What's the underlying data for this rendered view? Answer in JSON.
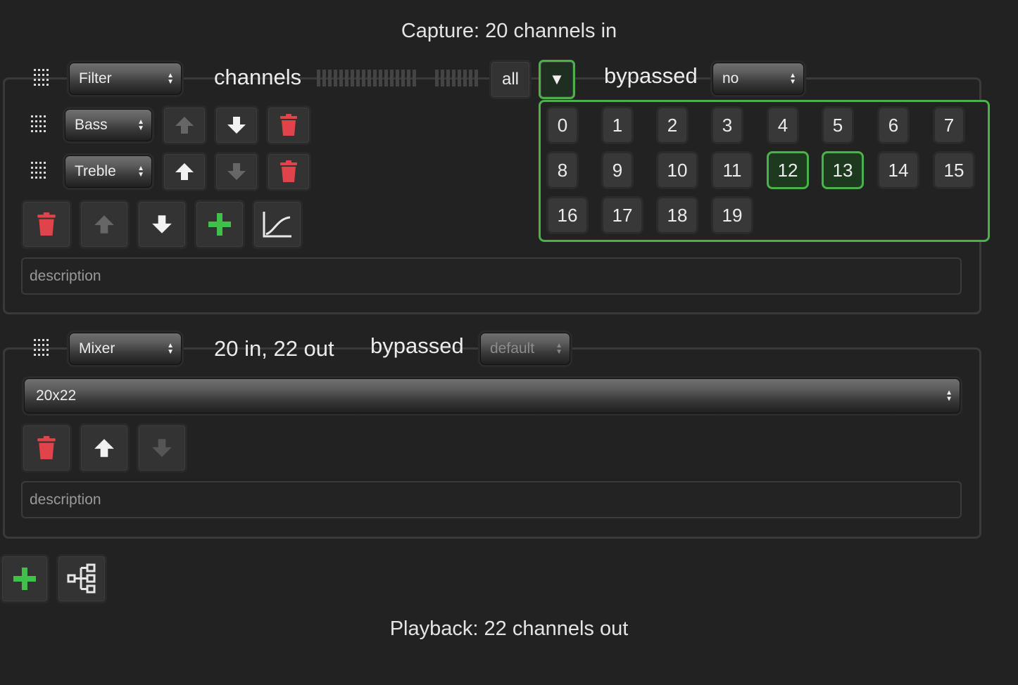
{
  "capture_title": "Capture: 20 channels in",
  "playback_title": "Playback: 22 channels out",
  "filter_step": {
    "type_select": "Filter",
    "channels_label": "channels",
    "all_button": "all",
    "dropdown_toggle": "▼",
    "bypassed_label": "bypassed",
    "bypassed_value": "no",
    "filters": [
      {
        "name": "Bass"
      },
      {
        "name": "Treble"
      }
    ],
    "channel_options": [
      "0",
      "1",
      "2",
      "3",
      "4",
      "5",
      "6",
      "7",
      "8",
      "9",
      "10",
      "11",
      "12",
      "13",
      "14",
      "15",
      "16",
      "17",
      "18",
      "19"
    ],
    "selected_channels": [
      "12",
      "13"
    ],
    "description_placeholder": "description"
  },
  "mixer_step": {
    "type_select": "Mixer",
    "io_label": "20 in, 22 out",
    "bypassed_label": "bypassed",
    "bypassed_value": "default",
    "mixer_select": "20x22",
    "description_placeholder": "description"
  },
  "colors": {
    "background": "#222222",
    "accent_green": "#4cb04c",
    "delete_red": "#e0444a"
  },
  "icons": {
    "drag": "drag-handle-icon",
    "trash": "trash-icon",
    "up": "arrow-up-icon",
    "down": "arrow-down-icon",
    "add": "plus-icon",
    "plot": "plot-icon",
    "tree": "tree-icon"
  }
}
